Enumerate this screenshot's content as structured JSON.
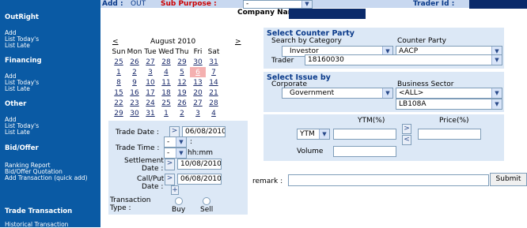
{
  "sidebar": {
    "outright": {
      "title": "OutRight",
      "links": [
        "Add",
        "List Today's",
        "List Late"
      ]
    },
    "financing": {
      "title": "Financing",
      "links": [
        "Add",
        "List Today's",
        "List Late"
      ]
    },
    "other": {
      "title": "Other",
      "links": [
        "Add",
        "List Today's",
        "List Late"
      ]
    },
    "bidoffer": {
      "title": "Bid/Offer",
      "links": [
        "Ranking Report",
        "Bid/Offer Quotation",
        "Add Transaction (quick add)"
      ]
    },
    "trade": {
      "title": "Trade Transaction",
      "links": [
        "Historical Transaction"
      ]
    }
  },
  "topbar": {
    "add_label": "Add :",
    "add_value": "OUT",
    "sub_purpose_label": "Sub Purpose :",
    "sub_purpose_value": "-",
    "trader_id_label": "Trader Id :",
    "company_name_label": "Company Name"
  },
  "calendar": {
    "prev": "<",
    "next": ">",
    "month": "August 2010",
    "weekdays": [
      "Sun",
      "Mon",
      "Tue",
      "Wed",
      "Thu",
      "Fri",
      "Sat"
    ],
    "weeks": [
      [
        "25",
        "26",
        "27",
        "28",
        "29",
        "30",
        "31"
      ],
      [
        "1",
        "2",
        "3",
        "4",
        "5",
        "6",
        "7"
      ],
      [
        "8",
        "9",
        "10",
        "11",
        "12",
        "13",
        "14"
      ],
      [
        "15",
        "16",
        "17",
        "18",
        "19",
        "20",
        "21"
      ],
      [
        "22",
        "23",
        "24",
        "25",
        "26",
        "27",
        "28"
      ],
      [
        "29",
        "30",
        "31",
        "1",
        "2",
        "3",
        "4"
      ]
    ],
    "selected": "6",
    "selected_color": "#f4b0b0"
  },
  "trade_form": {
    "trade_date_label": "Trade Date :",
    "trade_date_value": "06/08/2010",
    "trade_time_label": "Trade Time :",
    "hour_value": "-",
    "minute_value": "-",
    "time_sep": ":",
    "hhmm": "hh:mm",
    "settlement_label": "Settlement",
    "settlement_label2": "Date :",
    "settlement_value": "10/08/2010",
    "callput_label": "Call/Put",
    "callput_label2": "Date :",
    "callput_value": "06/08/2010",
    "arrow": ">",
    "plus": "+",
    "transaction_label": "Transaction",
    "type_label": "Type :",
    "buy": "Buy",
    "sell": "Sell"
  },
  "counterparty": {
    "title": "Select Counter Party",
    "search_label": "Search by Category",
    "category_value": "Investor",
    "counter_label": "Counter Party",
    "counter_value": "AACP",
    "trader_label": "Trader",
    "trader_value": "18160030"
  },
  "issue": {
    "title": "Select Issue by",
    "corporate_label": "Corporate",
    "corporate_value": "Government",
    "sector_label": "Business Sector",
    "sector_value": "<ALL>",
    "issue_value": "LB108A"
  },
  "pricing": {
    "ytm_label": "YTM(%)",
    "price_label": "Price(%)",
    "ytm_select": "YTM",
    "right_arrow": ">",
    "left_arrow": "<",
    "volume_label": "Volume"
  },
  "remark": {
    "label": "remark :",
    "submit": "Submit"
  },
  "colors": {
    "sidebar": "#0a5aa4",
    "panel": "#dce8f6",
    "sub_purpose": "#cc0000",
    "header_text": "#0a3a8a"
  }
}
